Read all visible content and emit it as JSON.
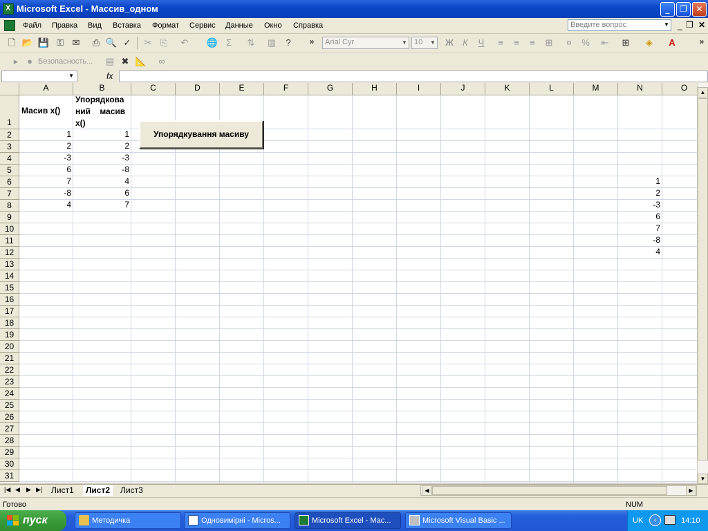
{
  "window": {
    "title": "Microsoft Excel - Массив_одном"
  },
  "menu": {
    "items": [
      "Файл",
      "Правка",
      "Вид",
      "Вставка",
      "Формат",
      "Сервис",
      "Данные",
      "Окно",
      "Справка"
    ],
    "help_placeholder": "Введите вопрос"
  },
  "toolbar": {
    "font_name": "Arial Cyr",
    "font_size": "10",
    "security_label": "Безопасность..."
  },
  "formula_bar": {
    "name_box": "",
    "fx_label": "fx",
    "formula": ""
  },
  "sheet": {
    "columns": [
      "A",
      "B",
      "C",
      "D",
      "E",
      "F",
      "G",
      "H",
      "I",
      "J",
      "K",
      "L",
      "M",
      "N",
      "O"
    ],
    "rows": [
      "1",
      "2",
      "3",
      "4",
      "5",
      "6",
      "7",
      "8",
      "9",
      "10",
      "11",
      "12",
      "13",
      "14",
      "15",
      "16",
      "17",
      "18",
      "19",
      "20",
      "21",
      "22",
      "23",
      "24",
      "25",
      "26",
      "27",
      "28",
      "29",
      "30",
      "31"
    ],
    "header_a1": "Масив x()",
    "header_b1_line1": "Упорядкова",
    "header_b1_line2": "ний масив",
    "header_b1_line3": "x()",
    "col_a": [
      "1",
      "2",
      "-3",
      "6",
      "7",
      "-8",
      "4"
    ],
    "col_b": [
      "1",
      "2",
      "-3",
      "-8",
      "4",
      "6",
      "7"
    ],
    "col_n": [
      "1",
      "2",
      "-3",
      "6",
      "7",
      "-8",
      "4"
    ],
    "button_label": "Упорядкування масиву"
  },
  "tabs": [
    "Лист1",
    "Лист2",
    "Лист3"
  ],
  "active_tab": "Лист2",
  "status": {
    "left": "Готово",
    "num": "NUM"
  },
  "taskbar": {
    "start_label": "пуск",
    "tasks": [
      "Методичка",
      "Одновимірні - Micros...",
      "Microsoft Excel - Мас...",
      "Microsoft Visual Basic ..."
    ],
    "lang": "UK",
    "clock": "14:10"
  }
}
